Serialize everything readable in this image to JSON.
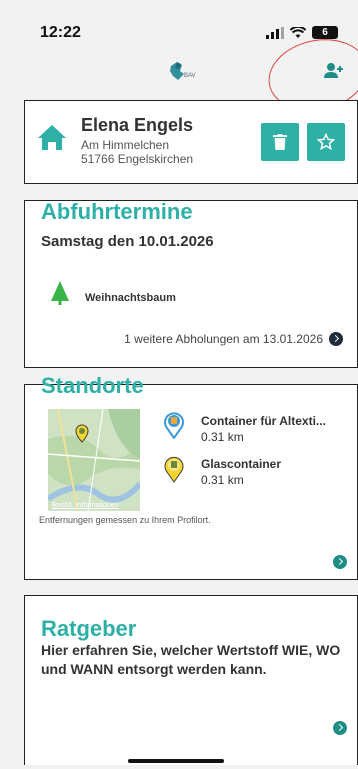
{
  "status_bar": {
    "time": "12:22",
    "battery": "6"
  },
  "colors": {
    "accent": "#2fb0a7",
    "dark": "#1e2b3b",
    "highlight_circle": "#d9443f"
  },
  "header": {
    "logo_icon": "bav-logo-icon",
    "add_user_icon": "add-user-icon"
  },
  "profile": {
    "name": "Elena Engels",
    "street": "Am Himmelchen",
    "city": "51766  Engelskirchen",
    "delete_icon": "trash-icon",
    "favorite_icon": "star-icon"
  },
  "abfuhr": {
    "title": "Abfuhrtermine",
    "date": "Samstag den 10.01.2026",
    "item_label": "Weihnachtsbaum",
    "more_text": "1 weitere Abholungen am 13.01.2026"
  },
  "standorte": {
    "title": "Standorte",
    "map_legal": "Rechtl. Informationen",
    "locations": [
      {
        "name": "Container für Altexti...",
        "distance": "0.31 km"
      },
      {
        "name": "Glascontainer",
        "distance": "0.31 km"
      }
    ],
    "note": "Entfernungen gemessen zu Ihrem Profilort."
  },
  "ratgeber": {
    "title": "Ratgeber",
    "text": "Hier erfahren Sie, welcher Wertstoff WIE, WO und WANN entsorgt werden kann."
  }
}
